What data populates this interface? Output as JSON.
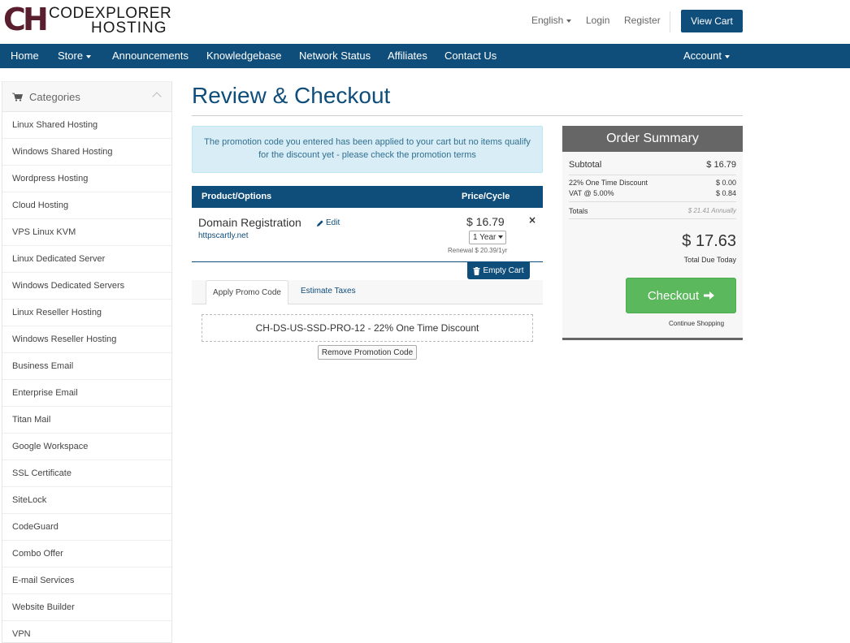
{
  "brand": {
    "line1": "CODEXPLORER",
    "line2": "HOSTING",
    "mark": "CH",
    "mark_color": "#5a1f2e"
  },
  "colors": {
    "primary": "#0f4d7a",
    "success": "#5cb85c",
    "alert_bg": "#d9edf7",
    "alert_text": "#31708f",
    "summary_head": "#666666"
  },
  "top_links": {
    "language": "English",
    "login": "Login",
    "register": "Register",
    "view_cart": "View Cart"
  },
  "nav": {
    "items": [
      "Home",
      "Store",
      "Announcements",
      "Knowledgebase",
      "Network Status",
      "Affiliates",
      "Contact Us"
    ],
    "account": "Account"
  },
  "sidebar": {
    "title": "Categories",
    "items": [
      "Linux Shared Hosting",
      "Windows Shared Hosting",
      "Wordpress Hosting",
      "Cloud Hosting",
      "VPS Linux KVM",
      "Linux Dedicated Server",
      "Windows Dedicated Servers",
      "Linux Reseller Hosting",
      "Windows Reseller Hosting",
      "Business Email",
      "Enterprise Email",
      "Titan Mail",
      "Google Workspace",
      "SSL Certificate",
      "SiteLock",
      "CodeGuard",
      "Combo Offer",
      "E-mail Services",
      "Website Builder",
      "VPN"
    ]
  },
  "main": {
    "title": "Review & Checkout",
    "alert": "The promotion code you entered has been applied to your cart but no items qualify for the discount yet - please check the promotion terms",
    "table": {
      "col_product": "Product/Options",
      "col_price": "Price/Cycle"
    },
    "item": {
      "name": "Domain Registration",
      "edit": "Edit",
      "domain": "httpscartly.net",
      "price": "$ 16.79",
      "cycle": "1 Year",
      "renewal": "Renewal $ 20.39/1yr",
      "remove": "×"
    },
    "empty_cart": "Empty Cart",
    "tabs": {
      "promo": "Apply Promo Code",
      "taxes": "Estimate Taxes"
    },
    "promo_code": "CH-DS-US-SSD-PRO-12 - 22% One Time Discount",
    "remove_promo": "Remove Promotion Code"
  },
  "summary": {
    "title": "Order Summary",
    "subtotal_label": "Subtotal",
    "subtotal": "$ 16.79",
    "discount_label": "22% One Time Discount",
    "discount": "$ 0.00",
    "vat_label": "VAT @ 5.00%",
    "vat": "$ 0.84",
    "totals_label": "Totals",
    "totals": "$ 21.41 Annually",
    "total": "$ 17.63",
    "total_due": "Total Due Today",
    "checkout": "Checkout",
    "continue": "Continue Shopping"
  },
  "icons": {
    "cart": "cart-icon",
    "pencil": "pencil-icon",
    "trash": "trash-icon",
    "arrow": "arrow-right-icon",
    "chevron": "chevron-up-icon"
  }
}
